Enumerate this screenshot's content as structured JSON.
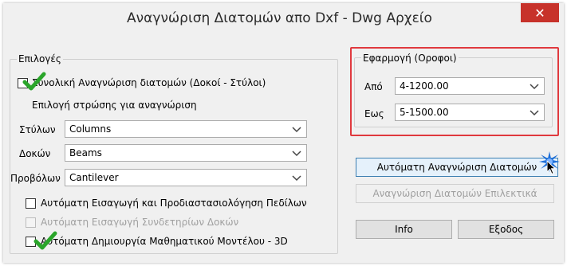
{
  "window": {
    "title": "Αναγνώριση Διατομών απο Dxf - Dwg Αρχείο",
    "close_glyph": "✕"
  },
  "options": {
    "legend": "Επιλογές",
    "total_recognition": {
      "label": "Συνολική Αναγνώριση διατομών (Δοκοί - Στύλοι)",
      "checked": true
    },
    "layer_heading": "Επιλογή στρώσης για αναγνώριση",
    "columns": {
      "label": "Στύλων",
      "value": "Columns"
    },
    "beams": {
      "label": "Δοκών",
      "value": "Beams"
    },
    "cantilevers": {
      "label": "Προβόλων",
      "value": "Cantilever"
    },
    "auto_insert_slabs": {
      "label": "Αυτόματη Εισαγωγή και Προδιαστασιολόγηση Πεδίλων",
      "checked": false
    },
    "auto_insert_ties": {
      "label": "Αυτόματη Εισαγωγή Συνδετηρίων Δοκών",
      "checked": false,
      "disabled": true
    },
    "auto_create_model": {
      "label": "Αυτόματη Δημιουργία Μαθηματικού Μοντέλου - 3D",
      "checked": true
    }
  },
  "application": {
    "legend": "Εφαρμογή (Οροφοι)",
    "from": {
      "label": "Από",
      "value": "4-1200.00"
    },
    "to": {
      "label": "Εως",
      "value": "5-1500.00"
    }
  },
  "buttons": {
    "auto_recognition": "Αυτόματη Αναγνώριση Διατομών",
    "selective_recognition": "Αναγνώριση Διατομών Επιλεκτικά",
    "info": "Info",
    "exit": "Εξοδος"
  },
  "colors": {
    "highlight_border": "#e0393e",
    "check_green": "#2aa52a",
    "close_red": "#c7322a",
    "focus_blue": "#3c7fb1"
  }
}
